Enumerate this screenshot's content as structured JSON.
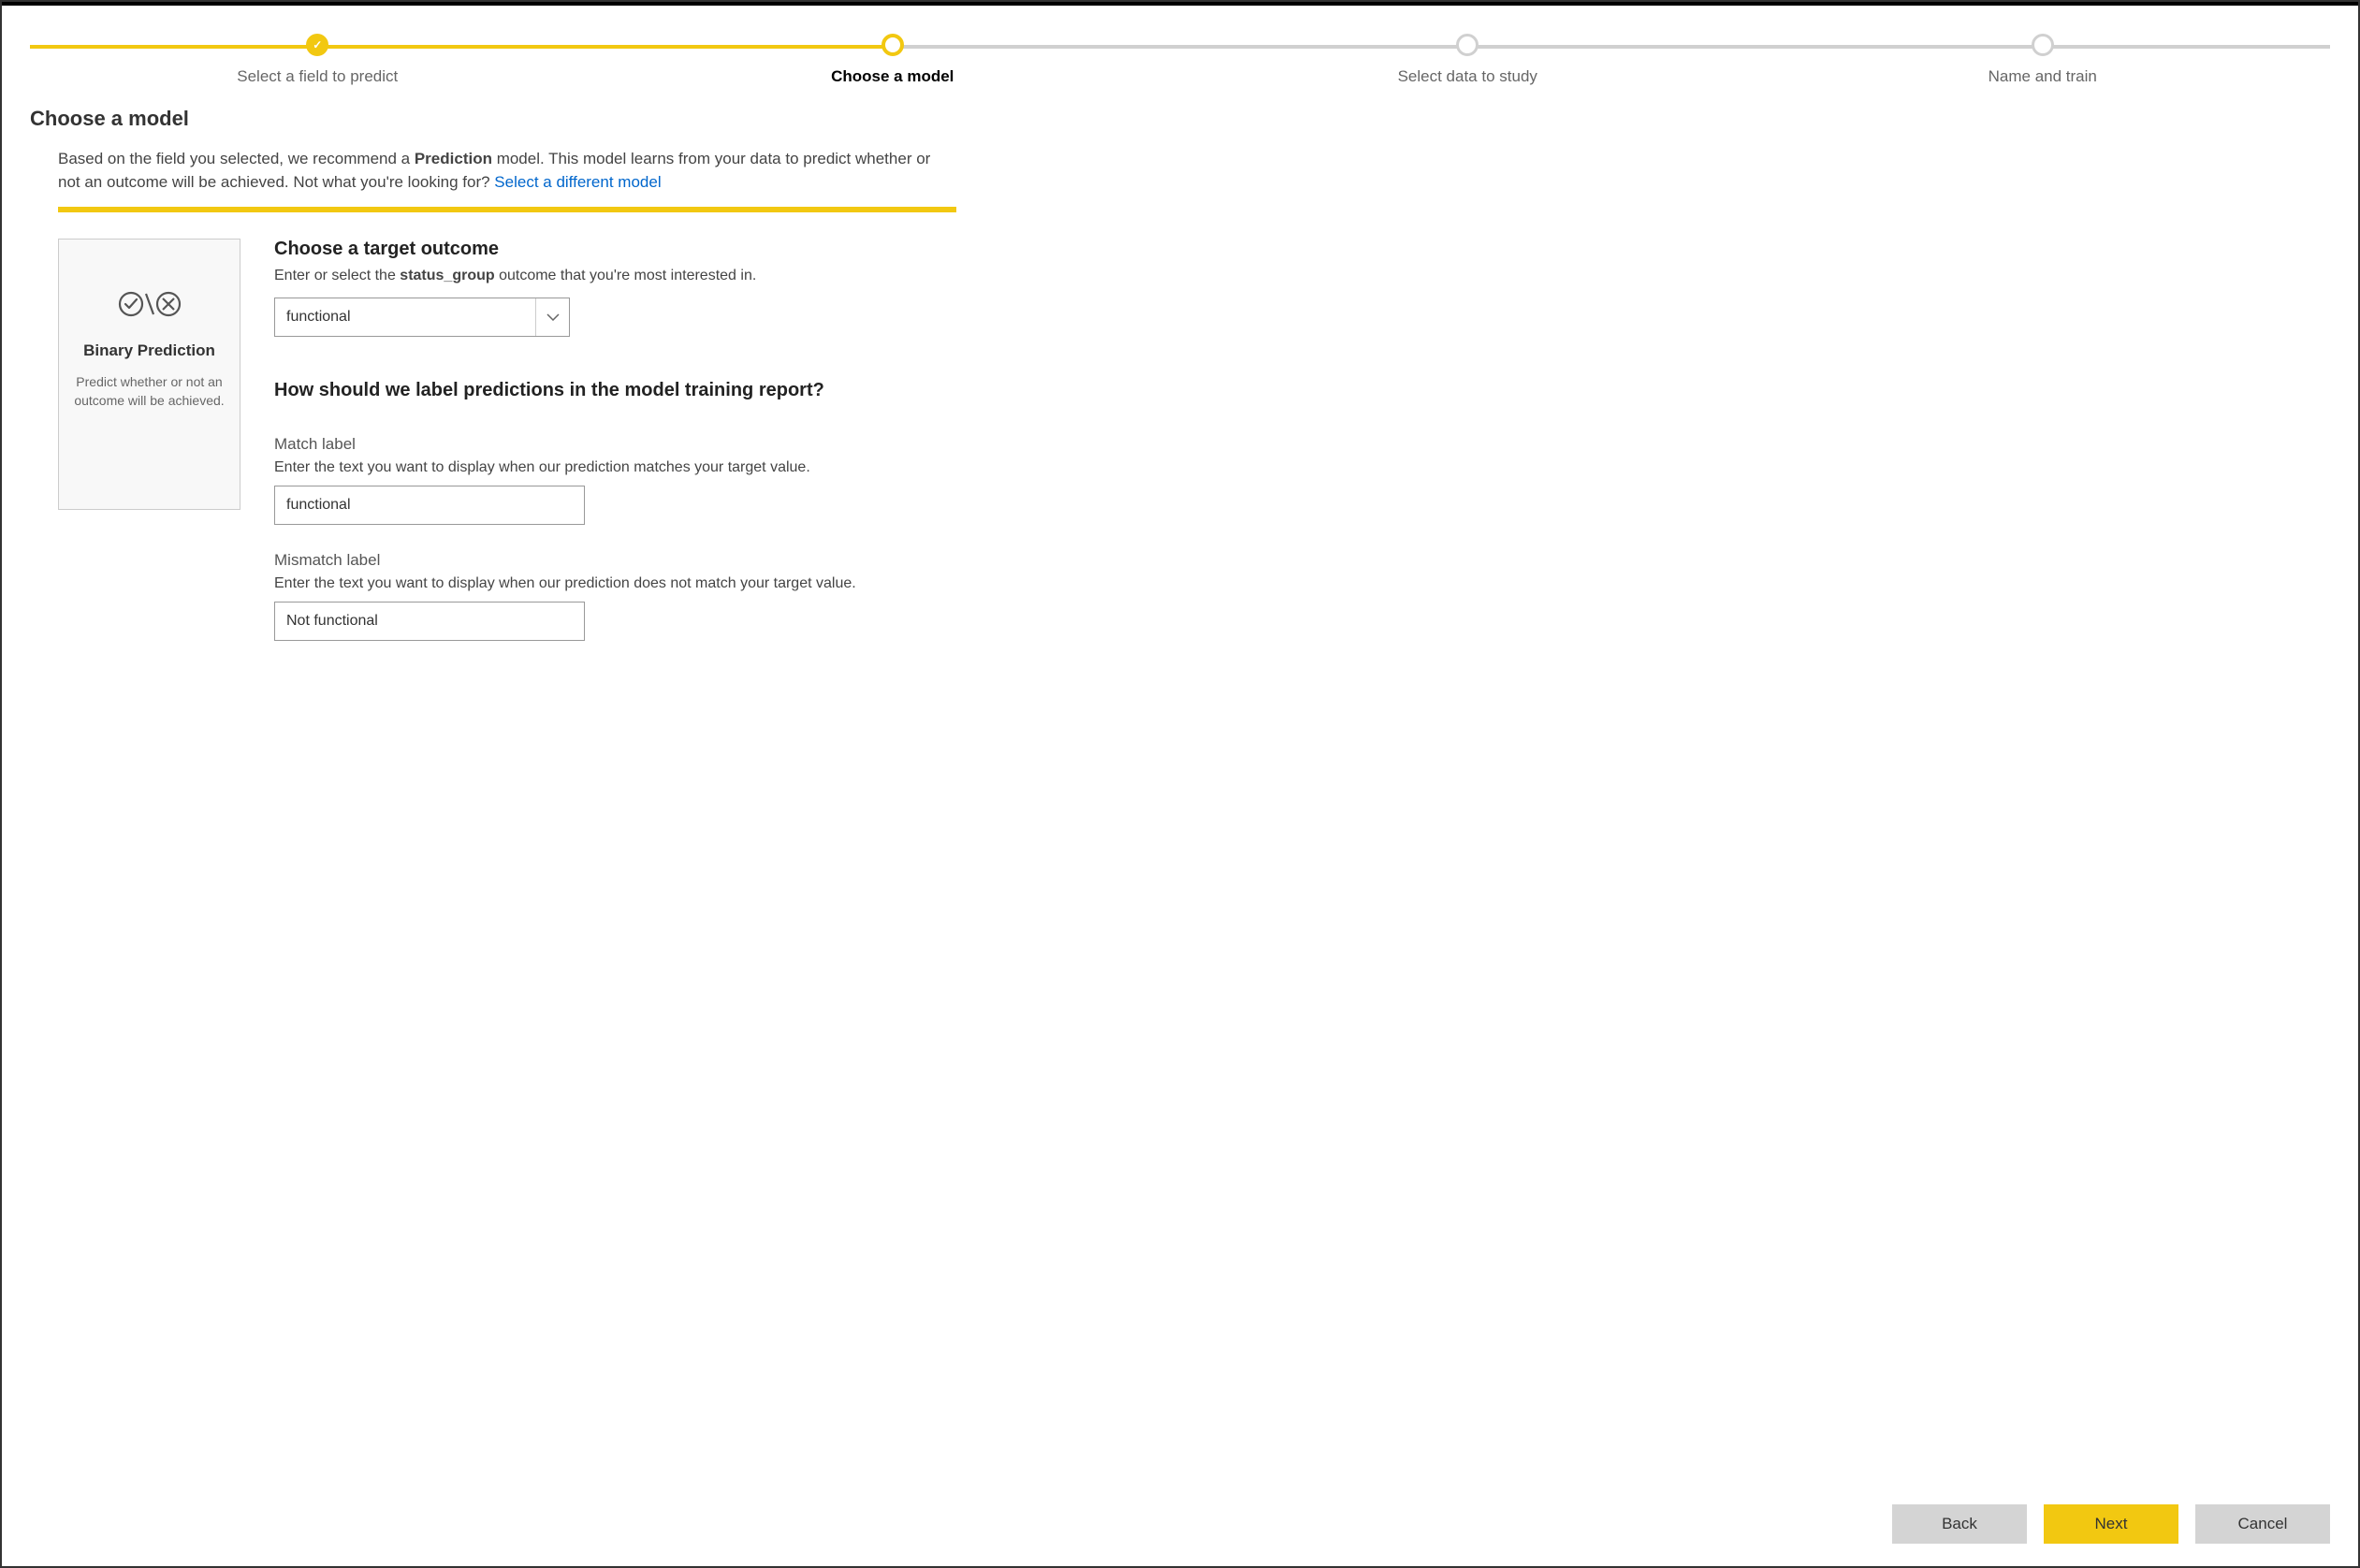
{
  "stepper": {
    "steps": [
      {
        "label": "Select a field to predict",
        "state": "completed"
      },
      {
        "label": "Choose a model",
        "state": "current"
      },
      {
        "label": "Select data to study",
        "state": "upcoming"
      },
      {
        "label": "Name and train",
        "state": "upcoming"
      }
    ]
  },
  "page_title": "Choose a model",
  "intro": {
    "text_before": "Based on the field you selected, we recommend a ",
    "model_word": "Prediction",
    "text_mid": " model. This model learns from your data to predict whether or not an outcome will be achieved. Not what you're looking for? ",
    "link_text": "Select a different model"
  },
  "model_card": {
    "title": "Binary Prediction",
    "desc": "Predict whether or not an outcome will be achieved."
  },
  "target": {
    "heading": "Choose a target outcome",
    "desc_before": "Enter or select the ",
    "field_name": "status_group",
    "desc_after": " outcome that you're most interested in.",
    "value": "functional"
  },
  "labels_section": {
    "heading": "How should we label predictions in the model training report?"
  },
  "match": {
    "label": "Match label",
    "desc": "Enter the text you want to display when our prediction matches your target value.",
    "value": "functional"
  },
  "mismatch": {
    "label": "Mismatch label",
    "desc": "Enter the text you want to display when our prediction does not match your target value.",
    "value": "Not functional"
  },
  "footer": {
    "back": "Back",
    "next": "Next",
    "cancel": "Cancel"
  }
}
